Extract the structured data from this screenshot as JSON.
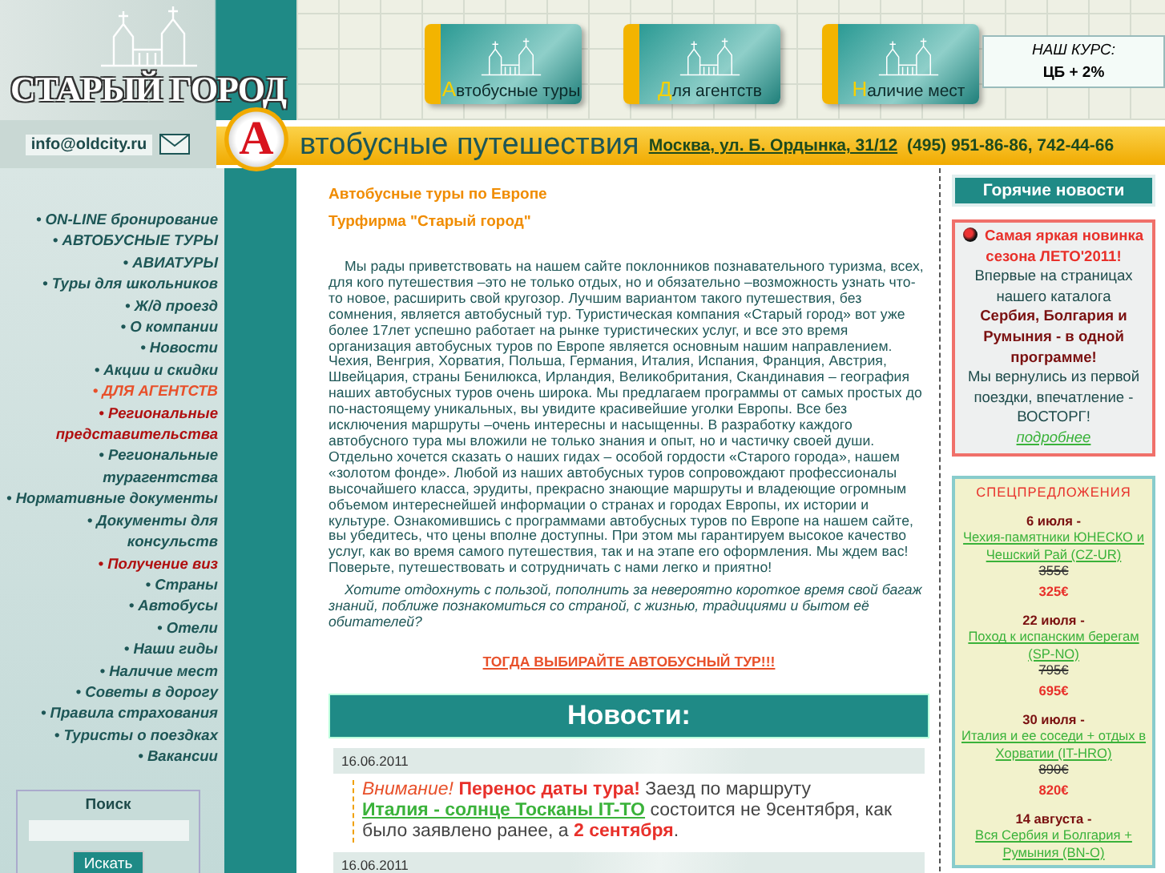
{
  "header": {
    "logo": "СТАРЫЙ ГОРОД",
    "email": "info@oldcity.ru",
    "cards": [
      {
        "label": "Автобусные туры"
      },
      {
        "label": "Для агентств"
      },
      {
        "label": "Наличие мест"
      }
    ],
    "rate": {
      "title": "НАШ КУРС:",
      "value": "ЦБ + 2%"
    },
    "banner": {
      "letter": "А",
      "title": "втобусные путешествия",
      "address": "Москва, ул. Б. Ордынка, 31/12",
      "phone": "(495) 951-86-86, 742-44-66"
    }
  },
  "nav": [
    {
      "label": "• ON-LINE бронирование",
      "color": "#1d5656"
    },
    {
      "label": "• АВТОБУСНЫЕ ТУРЫ",
      "color": "#1d5656"
    },
    {
      "label": "• АВИАТУРЫ",
      "color": "#1d5656"
    },
    {
      "label": "• Туры для школьников",
      "color": "#1d5656"
    },
    {
      "label": "• Ж/д проезд",
      "color": "#1d5656"
    },
    {
      "label": "• О компании",
      "color": "#1d5656"
    },
    {
      "label": "• Новости",
      "color": "#1d5656"
    },
    {
      "label": "• Акции и скидки",
      "color": "#1d5656"
    },
    {
      "label": "• ДЛЯ АГЕНТСТВ",
      "color": "#e8502a"
    },
    {
      "label": "• Региональные представительства",
      "color": "#b01010"
    },
    {
      "label": "• Региональные турагентства",
      "color": "#1d5656"
    },
    {
      "label": "• Нормативные документы",
      "color": "#1d5656"
    },
    {
      "label": "• Документы для консульств",
      "color": "#1d5656"
    },
    {
      "label": "• Получение виз",
      "color": "#b01010"
    },
    {
      "label": "• Страны",
      "color": "#1d5656"
    },
    {
      "label": "• Автобусы",
      "color": "#1d5656"
    },
    {
      "label": "• Отели",
      "color": "#1d5656"
    },
    {
      "label": "• Наши гиды",
      "color": "#1d5656"
    },
    {
      "label": "• Наличие мест",
      "color": "#1d5656"
    },
    {
      "label": "• Советы в дорогу",
      "color": "#1d5656"
    },
    {
      "label": "• Правила страхования",
      "color": "#1d5656"
    },
    {
      "label": "• Туристы о поездках",
      "color": "#1d5656"
    },
    {
      "label": "• Вакансии",
      "color": "#1d5656"
    }
  ],
  "search": {
    "title": "Поиск",
    "button": "Искать"
  },
  "main": {
    "headings": [
      "Автобусные туры по Европе",
      "Турфирма \"Старый город\""
    ],
    "intro": "Мы рады приветствовать на нашем сайте поклонников познавательного туризма, всех, для кого путешествия –это не только отдых, но и обязательно –возможность узнать что-то новое, расширить свой кругозор. Лучшим вариантом такого путешествия, без сомнения, является автобусный тур. Туристическая компания «Старый город» вот уже более 17лет успешно работает на рынке туристических услуг, и все это время организация автобусных туров по Европе является основным нашим направлением. Чехия, Венгрия, Хорватия, Польша, Германия, Италия, Испания, Франция, Австрия, Швейцария, страны Бенилюкса, Ирландия, Великобритания, Скандинавия – география наших автобусных туров очень широка. Мы предлагаем программы от самых простых до по-настоящему уникальных, вы увидите красивейшие уголки Европы. Все без исключения маршруты –очень интересны и насыщенны. В разработку каждого автобусного тура мы вложили не только знания и опыт, но и частичку своей души. Отдельно хочется сказать о наших гидах – особой гордости «Старого города», нашем «золотом фонде». Любой из наших автобусных туров сопровождают профессионалы высочайшего класса, эрудиты, прекрасно знающие маршруты и владеющие огромным объемом интереснейшей информации о странах и городах Европы, их истории и культуре. Ознакомившись с программами автобусных туров по Европе на нашем сайте, вы убедитесь, что цены вполне доступны. При этом мы гарантируем высокое качество услуг, как во время самого путешествия, так и на этапе его оформления. Мы ждем вас! Поверьте, путешествовать и сотрудничать с нами легко и приятно!",
    "question": "Хотите отдохнуть с пользой, пополнить за невероятно короткое время свой багаж знаний, поближе познакомиться со страной, с жизнью, традициями и бытом её обитателей?",
    "cta": "ТОГДА ВЫБИРАЙТЕ АВТОБУСНЫЙ ТУР!!!",
    "news_title": "Новости:",
    "news": [
      {
        "date": "16.06.2011",
        "segments": [
          {
            "kind": "alert",
            "text": "Внимание!"
          },
          {
            "kind": "headline",
            "text": "Перенос даты тура!"
          },
          {
            "kind": "text",
            "text": "Заезд по маршруту"
          },
          {
            "kind": "link",
            "text": "Италия - солнце Тосканы IT-TO"
          },
          {
            "kind": "text",
            "text": "состоится не 9сентября, как было заявлено ранее, а"
          },
          {
            "kind": "highlight",
            "text": "2 сентября"
          },
          {
            "kind": "text",
            "text": "."
          }
        ]
      },
      {
        "date": "16.06.2011"
      }
    ]
  },
  "hot": {
    "title": "Горячие новости",
    "headline": "Самая яркая новинка сезона ЛЕТО'2011!",
    "intro": "Впервые на страницах нашего каталога",
    "bold": "Сербия, Болгария и Румыния - в одной программе!",
    "text": "Мы вернулись из первой поездки, впечатление - ВОСТОРГ!",
    "more": "подробнее"
  },
  "specials": {
    "title": "СПЕЦПРЕДЛОЖЕНИЯ",
    "items": [
      {
        "date": "6 июля -",
        "link": "Чехия-памятники ЮНЕСКО и Чешский Рай (CZ-UR)",
        "old_price": "355€",
        "price": "325€"
      },
      {
        "date": "22 июля -",
        "link": "Поход к испанским берегам (SP-NO)",
        "old_price": "795€",
        "price": "695€"
      },
      {
        "date": "30 июля -",
        "link": "Италия и ее соседи + отдых в Хорватии (IT-HRO)",
        "old_price": "890€",
        "price": "820€"
      },
      {
        "date": "14 августа -",
        "link": "Вся Сербия и Болгария + Румыния (BN-O)"
      }
    ]
  }
}
